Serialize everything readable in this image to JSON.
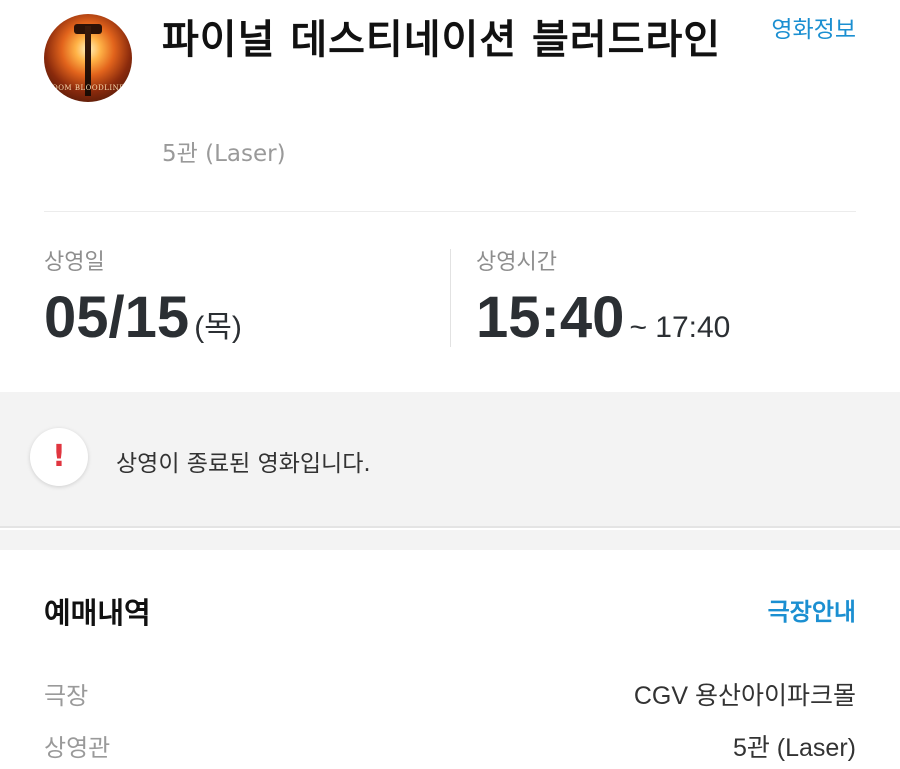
{
  "movie": {
    "title": "파이널 데스티네이션 블러드라인",
    "screen": "5관 (Laser)",
    "info_link": "영화정보",
    "poster_text": "DOOM BLOODLINES"
  },
  "showing": {
    "date_label": "상영일",
    "date": "05/15",
    "weekday": "(목)",
    "time_label": "상영시간",
    "start": "15:40",
    "end": "~ 17:40"
  },
  "notice": {
    "icon": "exclamation-icon",
    "icon_glyph": "!",
    "text": "상영이 종료된 영화입니다.",
    "accent_color": "#e0353f"
  },
  "booking": {
    "section_title": "예매내역",
    "theater_link": "극장안내",
    "rows": [
      {
        "label": "극장",
        "value": "CGV 용산아이파크몰"
      },
      {
        "label": "상영관",
        "value": "5관 (Laser)"
      }
    ]
  },
  "colors": {
    "link": "#1b8fd1",
    "muted": "#9a9a9a"
  }
}
